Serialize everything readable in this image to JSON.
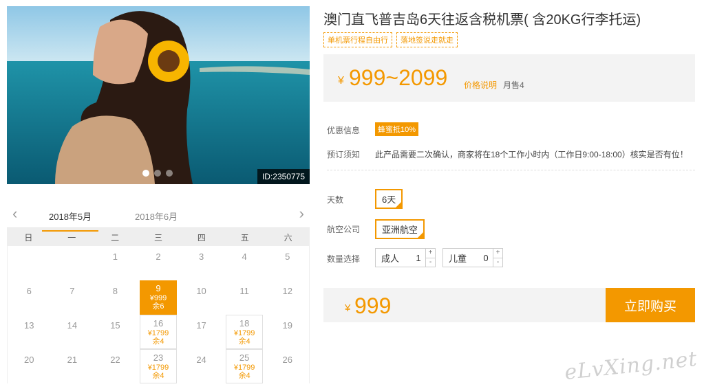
{
  "product": {
    "title": "澳门直飞普吉岛6天往返含税机票( 含20KG行李托运)",
    "tags": [
      "单机票行程自由行",
      "落地签说走就走"
    ],
    "image_id": "ID:2350775",
    "price_yen": "¥",
    "price_range": "999~2099",
    "price_note": "价格说明",
    "monthly_sales": "月售4"
  },
  "info": {
    "promo_label": "优惠信息",
    "promo_badge": "蜂蜜抵10%",
    "notice_label": "预订须知",
    "notice_text": "此产品需要二次确认，商家将在18个工作小时内（工作日9:00-18:00）核实是否有位！"
  },
  "options": {
    "days_label": "天数",
    "days_value": "6天",
    "airline_label": "航空公司",
    "airline_value": "亚洲航空",
    "qty_label": "数量选择",
    "adult_label": "成人",
    "adult_value": "1",
    "child_label": "儿童",
    "child_value": "0",
    "plus": "+",
    "minus": "-"
  },
  "buy": {
    "yen": "¥",
    "price": "999",
    "button": "立即购买"
  },
  "calendar": {
    "prev": "‹",
    "next": "›",
    "months": [
      "2018年5月",
      "2018年6月"
    ],
    "weekdays": [
      "日",
      "一",
      "二",
      "三",
      "四",
      "五",
      "六"
    ],
    "cells": [
      {
        "d": ""
      },
      {
        "d": ""
      },
      {
        "d": "1"
      },
      {
        "d": "2"
      },
      {
        "d": "3"
      },
      {
        "d": "4"
      },
      {
        "d": "5"
      },
      {
        "d": "6"
      },
      {
        "d": "7"
      },
      {
        "d": "8"
      },
      {
        "d": "9",
        "price": "¥999",
        "rem": "余6",
        "state": "selected"
      },
      {
        "d": "10"
      },
      {
        "d": "11"
      },
      {
        "d": "12"
      },
      {
        "d": "13"
      },
      {
        "d": "14"
      },
      {
        "d": "15"
      },
      {
        "d": "16",
        "price": "¥1799",
        "rem": "余4",
        "state": "available"
      },
      {
        "d": "17"
      },
      {
        "d": "18",
        "price": "¥1799",
        "rem": "余4",
        "state": "available"
      },
      {
        "d": "19"
      },
      {
        "d": "20"
      },
      {
        "d": "21"
      },
      {
        "d": "22"
      },
      {
        "d": "23",
        "price": "¥1799",
        "rem": "余4",
        "state": "available"
      },
      {
        "d": "24"
      },
      {
        "d": "25",
        "price": "¥1799",
        "rem": "余4",
        "state": "available"
      },
      {
        "d": "26"
      }
    ]
  },
  "watermark": "eLvXing.net",
  "colors": {
    "accent": "#f39800",
    "panel": "#f3f3f3"
  }
}
